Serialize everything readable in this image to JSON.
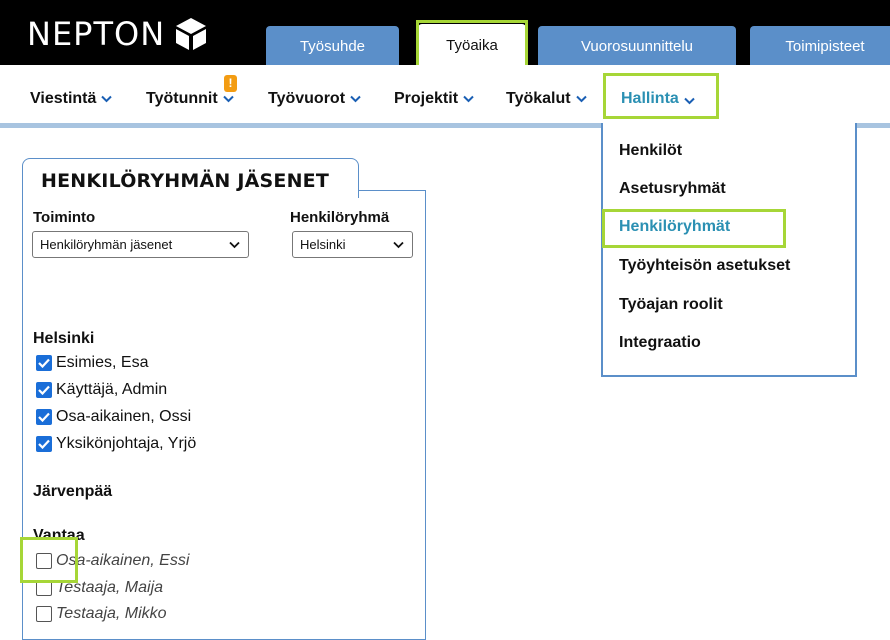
{
  "brand": {
    "name": "NEPTON",
    "logo_icon": "nepton-cube-icon"
  },
  "tabs": [
    {
      "label": "Työsuhde",
      "active": false
    },
    {
      "label": "Työaika",
      "active": true
    },
    {
      "label": "Vuorosuunnittelu",
      "active": false
    },
    {
      "label": "Toimipisteet",
      "active": false
    }
  ],
  "nav": {
    "items": [
      {
        "label": "Viestintä",
        "icon": "chevron-down-icon"
      },
      {
        "label": "Työtunnit",
        "icon": "chevron-down-icon",
        "badge": "!"
      },
      {
        "label": "Työvuorot",
        "icon": "chevron-down-icon"
      },
      {
        "label": "Projektit",
        "icon": "chevron-down-icon"
      },
      {
        "label": "Työkalut",
        "icon": "chevron-down-icon"
      },
      {
        "label": "Hallinta",
        "icon": "chevron-down-icon",
        "active": true
      }
    ]
  },
  "dropdown": {
    "items": [
      {
        "label": "Henkilöt"
      },
      {
        "label": "Asetusryhmät"
      },
      {
        "label": "Henkilöryhmät",
        "active": true
      },
      {
        "label": "Työyhteisön asetukset"
      },
      {
        "label": "Työajan roolit"
      },
      {
        "label": "Integraatio"
      }
    ]
  },
  "panel": {
    "title": "HENKILÖRYHMÄN JÄSENET",
    "toiminto_label": "Toiminto",
    "toiminto_value": "Henkilöryhmän jäsenet",
    "ryhma_label": "Henkilöryhmä",
    "ryhma_value": "Helsinki",
    "groups": [
      {
        "name": "Helsinki",
        "members": [
          {
            "name": "Esimies, Esa",
            "checked": true
          },
          {
            "name": "Käyttäjä, Admin",
            "checked": true
          },
          {
            "name": "Osa-aikainen, Ossi",
            "checked": true
          },
          {
            "name": "Yksikönjohtaja, Yrjö",
            "checked": true
          }
        ]
      },
      {
        "name": "Järvenpää",
        "members": []
      },
      {
        "name": "Vantaa",
        "members": [
          {
            "name": "Osa-aikainen, Essi",
            "checked": false
          },
          {
            "name": "Testaaja, Maija",
            "checked": false
          },
          {
            "name": "Testaaja, Mikko",
            "checked": false
          }
        ]
      }
    ]
  },
  "colors": {
    "accent_tab": "#5b8fc9",
    "highlight": "#a6d637",
    "link_active": "#2b90b3",
    "checkbox": "#1a6ed8",
    "badge": "#f39c12"
  }
}
